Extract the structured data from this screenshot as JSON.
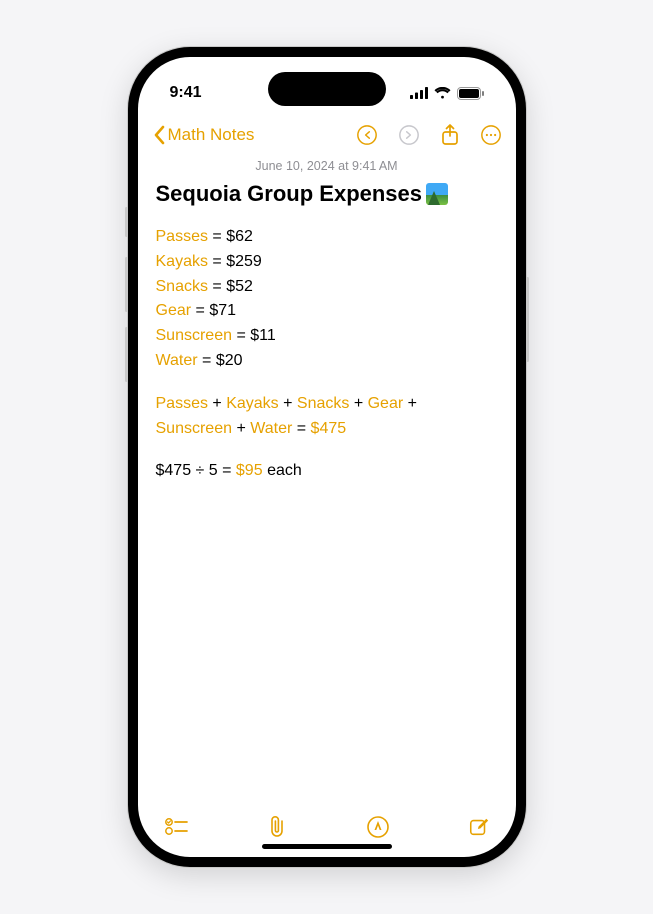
{
  "status": {
    "time": "9:41"
  },
  "nav": {
    "back_label": "Math Notes"
  },
  "note": {
    "timestamp": "June 10, 2024 at 9:41 AM",
    "title": "Sequoia Group Expenses",
    "expenses": [
      {
        "name": "Passes",
        "value": "$62"
      },
      {
        "name": "Kayaks",
        "value": "$259"
      },
      {
        "name": "Snacks",
        "value": "$52"
      },
      {
        "name": "Gear",
        "value": "$71"
      },
      {
        "name": "Sunscreen",
        "value": "$11"
      },
      {
        "name": "Water",
        "value": "$20"
      }
    ],
    "sum": {
      "line1_terms": [
        "Passes",
        "Kayaks",
        "Snacks",
        "Gear"
      ],
      "line2_terms": [
        "Sunscreen",
        "Water"
      ],
      "result": "$475"
    },
    "division": {
      "prefix": "$475 ÷ 5 =",
      "result": "$95",
      "suffix": "each"
    }
  }
}
